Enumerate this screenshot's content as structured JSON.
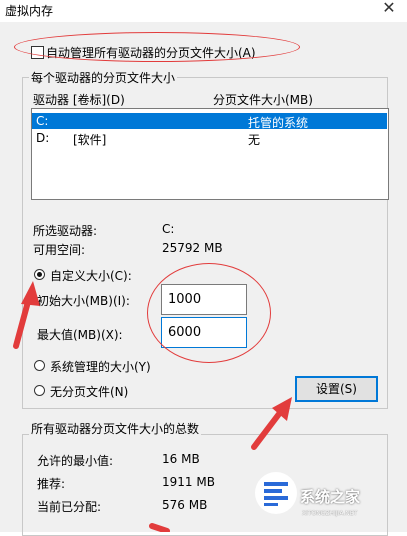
{
  "window": {
    "title": "虚拟内存",
    "close_icon": "close-icon"
  },
  "auto_manage": {
    "label": "自动管理所有驱动器的分页文件大小(A)",
    "checked": false
  },
  "drives_group": {
    "legend": "每个驱动器的分页文件大小",
    "headers": {
      "drive": "驱动器 [卷标](D)",
      "paging": "分页文件大小(MB)"
    },
    "rows": [
      {
        "drive": "C:",
        "label": "",
        "paging": "托管的系统",
        "selected": true
      },
      {
        "drive": "D:",
        "label": "[软件]",
        "paging": "无",
        "selected": false
      }
    ],
    "selected_drive_label": "所选驱动器:",
    "selected_drive_value": "C:",
    "free_space_label": "可用空间:",
    "free_space_value": "25792 MB",
    "custom_size_label": "自定义大小(C):",
    "initial_size_label": "初始大小(MB)(I):",
    "initial_size_value": "1000",
    "max_size_label": "最大值(MB)(X):",
    "max_size_value": "6000",
    "system_managed_label": "系统管理的大小(Y)",
    "no_paging_label": "无分页文件(N)",
    "set_button": "设置(S)",
    "selected_option": "custom"
  },
  "total_group": {
    "legend": "所有驱动器分页文件大小的总数",
    "min_label": "允许的最小值:",
    "min_value": "16 MB",
    "recommended_label": "推荐:",
    "recommended_value": "1911 MB",
    "current_label": "当前已分配:",
    "current_value": "576 MB"
  },
  "watermark": {
    "brand": "系统之家",
    "url": "XITONGZHIJIA.NET"
  },
  "colors": {
    "highlight": "#0078d7",
    "annotation": "#e23c3c",
    "dialog_bg": "#f0f0f0"
  }
}
